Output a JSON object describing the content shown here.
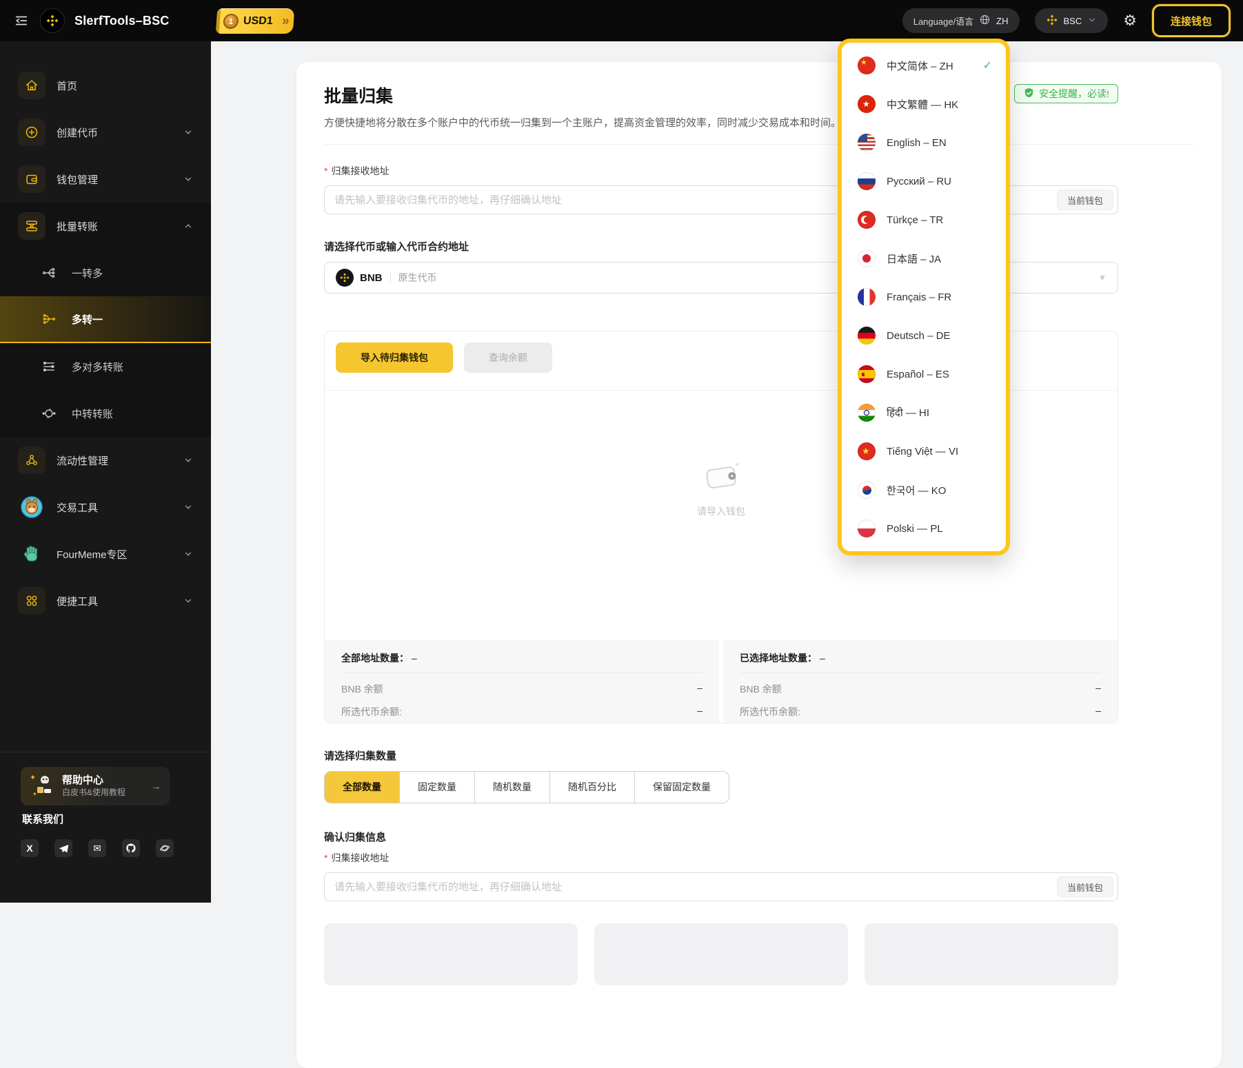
{
  "topbar": {
    "app_title": "SlerfTools–BSC",
    "usd1_coin": "1",
    "usd1_label": "USD1",
    "language_label": "Language/语言",
    "language_code": "ZH",
    "network_label": "BSC",
    "connect_wallet_label": "连接钱包"
  },
  "sidebar": {
    "items": [
      {
        "label": "首页",
        "icon": "home-icon"
      },
      {
        "label": "创建代币",
        "icon": "plus-circle-icon"
      },
      {
        "label": "钱包管理",
        "icon": "wallet-icon"
      },
      {
        "label": "批量转账",
        "icon": "batch-transfer-icon"
      },
      {
        "label": "一转多",
        "icon": "one-to-many-icon"
      },
      {
        "label": "多转一",
        "icon": "many-to-one-icon"
      },
      {
        "label": "多对多转账",
        "icon": "many-to-many-icon"
      },
      {
        "label": "中转转账",
        "icon": "relay-transfer-icon"
      },
      {
        "label": "流动性管理",
        "icon": "liquidity-icon"
      },
      {
        "label": "交易工具",
        "icon": "pancakeswap-icon"
      },
      {
        "label": "FourMeme专区",
        "icon": "hand-icon"
      },
      {
        "label": "便捷工具",
        "icon": "apps-grid-icon"
      }
    ],
    "help_title": "帮助中心",
    "help_subtitle": "白皮书&使用教程",
    "contact_title": "联系我们"
  },
  "language_menu": {
    "items": [
      {
        "label": "中文简体 – ZH",
        "flag": "cn",
        "selected": true
      },
      {
        "label": "中文繁體 — HK",
        "flag": "hk"
      },
      {
        "label": "English – EN",
        "flag": "us"
      },
      {
        "label": "Русский – RU",
        "flag": "ru"
      },
      {
        "label": "Türkçe – TR",
        "flag": "tr"
      },
      {
        "label": "日本語 – JA",
        "flag": "jp"
      },
      {
        "label": "Français – FR",
        "flag": "fr"
      },
      {
        "label": "Deutsch – DE",
        "flag": "de"
      },
      {
        "label": "Español – ES",
        "flag": "es"
      },
      {
        "label": "हिंदी — HI",
        "flag": "in"
      },
      {
        "label": "Tiếng Việt — VI",
        "flag": "vn"
      },
      {
        "label": "한국어 — KO",
        "flag": "kr"
      },
      {
        "label": "Polski — PL",
        "flag": "pl"
      }
    ]
  },
  "main": {
    "title": "批量归集",
    "description": "方便快捷地将分散在多个账户中的代币统一归集到一个主账户，提高资金管理的效率，同时减少交易成本和时间。",
    "safety_badge": "安全提醒，必读!",
    "receive_address": {
      "label": "归集接收地址",
      "placeholder": "请先输入要接收归集代币的地址，再仔细确认地址",
      "current_wallet_label": "当前钱包"
    },
    "token_select": {
      "label": "请选择代币或输入代币合约地址",
      "token": "BNB",
      "token_type": "原生代币"
    },
    "import_panel": {
      "import_button": "导入待归集钱包",
      "query_button": "查询余额",
      "empty_text": "请导入钱包",
      "stats": {
        "left": {
          "title": "全部地址数量：",
          "value": "–",
          "rows": [
            [
              "BNB 余额",
              "–"
            ],
            [
              "所选代币余额:",
              "–"
            ]
          ]
        },
        "right": {
          "title": "已选择地址数量：",
          "value": "–",
          "rows": [
            [
              "BNB 余额",
              "–"
            ],
            [
              "所选代币余额:",
              "–"
            ]
          ]
        }
      }
    },
    "amount_section": {
      "label": "请选择归集数量",
      "tabs": [
        "全部数量",
        "固定数量",
        "随机数量",
        "随机百分比",
        "保留固定数量"
      ],
      "selected": "全部数量"
    },
    "confirm_section": {
      "title": "确认归集信息",
      "address_label": "归集接收地址",
      "placeholder": "请先输入要接收归集代币的地址，再仔细确认地址",
      "current_wallet_label": "当前钱包"
    }
  },
  "colors": {
    "accent_yellow": "#F0B90B",
    "highlight_border": "#FFC61A",
    "badge_green": "#3CB64A",
    "selected_tab_bg": "#F5C73B"
  }
}
